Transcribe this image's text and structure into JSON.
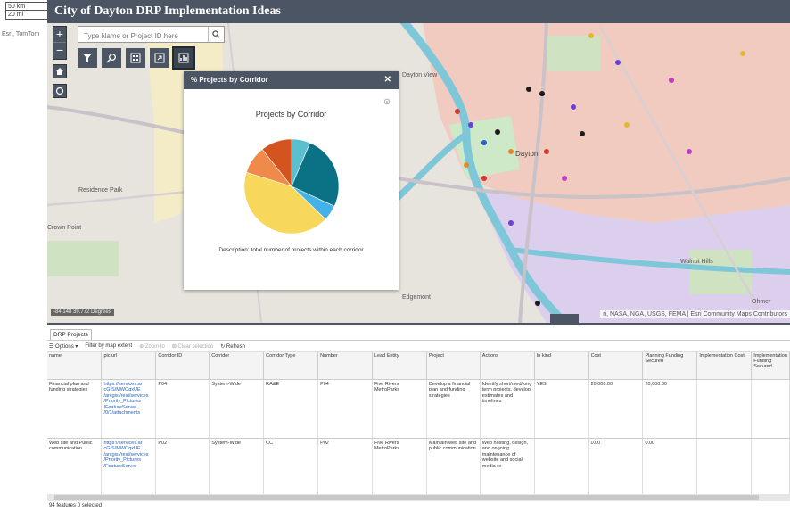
{
  "app": {
    "title": "City of Dayton DRP Implementation Ideas"
  },
  "scalebar": {
    "km": "50 km",
    "mi": "20 mi"
  },
  "attribution_small": "Esri, TomTom",
  "search": {
    "placeholder": "Type Name or Project ID here"
  },
  "zoom": {
    "in": "+",
    "out": "−"
  },
  "toolbar": {
    "tools": [
      "filter-icon",
      "search-map-icon",
      "chart-icon",
      "export-icon",
      "chart-active-icon"
    ]
  },
  "map_labels": {
    "dayton": "Dayton",
    "dayton_view": "Dayton View",
    "residence_park": "Residence Park",
    "crown_point": "Crown Point",
    "edgemont": "Edgemont",
    "walnut_hills": "Walnut Hills",
    "ohmer": "Ohmer"
  },
  "panel": {
    "title": "% Projects by Corridor",
    "chart_title": "Projects by Corridor",
    "description": "Description: total number of projects within each corridor"
  },
  "chart_data": {
    "type": "pie",
    "title": "Projects by Corridor",
    "values": [
      6,
      24,
      5,
      40,
      9,
      10
    ],
    "colors": [
      "#5bbfd0",
      "#0b7285",
      "#44b2e6",
      "#f8d85a",
      "#f08a4b",
      "#d4541f"
    ]
  },
  "map": {
    "coords": "-84.148 39.772 Degrees",
    "attribution": "ri, NASA, NGA, USGS, FEMA | Esri Community Maps Contributors"
  },
  "table": {
    "tab": "DRP Projects",
    "options": "Options",
    "filter": "Filter by map extent",
    "zoom_to": "Zoom to",
    "clear_selection": "Clear selection",
    "refresh": "Refresh",
    "columns": [
      "name",
      "pic url",
      "Corridor ID",
      "Corridor",
      "Corridor Type",
      "Number",
      "Lead Entity",
      "Project",
      "Actions",
      "In kind",
      "Cost",
      "Planning Funding Secured",
      "Implementation Cost",
      "Implementation Funding Secured"
    ],
    "rows": [
      [
        "Financial plan and funding strategies",
        "https://services.ar cGIS/MWOqxUE /arcgis /rest/services /Priority_Pictures /FeatureServer /0/1/attachments",
        "P04",
        "System-Wide",
        "RA&E",
        "P04",
        "Five Rivers MetroParks",
        "Develop a financial plan and funding strategies",
        "Identify short/med/long term projects, develop estimates and timelines",
        "YES",
        "20,000.00",
        "20,000.00",
        "",
        ""
      ],
      [
        "Web site and Public communication",
        "https://services.ar cGIS/MWOqxUE /arcgis /rest/services /Priority_Pictures /FeatureServer",
        "P02",
        "System-Wide",
        "CC",
        "P02",
        "Five Rivers MetroParks",
        "Maintain web site and public communication",
        "Web hosting, design, and ongoing maintenance of website and social media re",
        "",
        "0.00",
        "0.00",
        "",
        ""
      ]
    ],
    "status": "94 features 0 selected"
  }
}
